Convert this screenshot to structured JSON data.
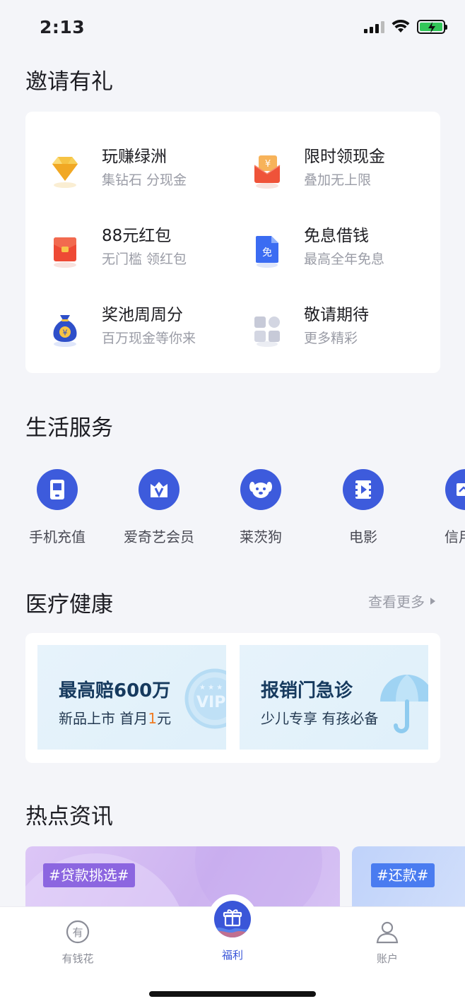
{
  "status_bar": {
    "time": "2:13"
  },
  "invite_section": {
    "title": "邀请有礼",
    "items": [
      {
        "title": "玩赚绿洲",
        "subtitle": "集钻石 分现金",
        "icon": "diamond-icon"
      },
      {
        "title": "限时领现金",
        "subtitle": "叠加无上限",
        "icon": "cash-envelope-icon"
      },
      {
        "title": "88元红包",
        "subtitle": "无门槛 领红包",
        "icon": "red-packet-icon"
      },
      {
        "title": "免息借钱",
        "subtitle": "最高全年免息",
        "icon": "interest-free-icon"
      },
      {
        "title": "奖池周周分",
        "subtitle": "百万现金等你来",
        "icon": "money-bag-icon"
      },
      {
        "title": "敬请期待",
        "subtitle": "更多精彩",
        "icon": "more-grid-icon"
      }
    ]
  },
  "life_section": {
    "title": "生活服务",
    "items": [
      {
        "label": "手机充值",
        "icon": "phone-recharge-icon"
      },
      {
        "label": "爱奇艺会员",
        "icon": "iqiyi-vip-icon"
      },
      {
        "label": "莱茨狗",
        "icon": "dog-icon"
      },
      {
        "label": "电影",
        "icon": "movie-icon"
      },
      {
        "label": "信用卡",
        "icon": "credit-card-icon"
      }
    ]
  },
  "medical_section": {
    "title": "医疗健康",
    "more": "查看更多",
    "banners": [
      {
        "title": "最高赔600万",
        "sub_pre": "新品上市 首月",
        "sub_hl": "1",
        "sub_post": "元",
        "badge": "VIP"
      },
      {
        "title": "报销门急诊",
        "subtitle": "少儿专享 有孩必备"
      }
    ]
  },
  "news_section": {
    "title": "热点资讯",
    "tags": [
      "#贷款挑选#",
      "#还款#"
    ]
  },
  "tab_bar": {
    "tabs": [
      {
        "label": "有钱花",
        "icon": "youqianhua-icon",
        "active": false
      },
      {
        "label": "福利",
        "icon": "gift-icon",
        "active": true
      },
      {
        "label": "账户",
        "icon": "user-icon",
        "active": false
      }
    ],
    "colors": {
      "active": "#3a56d8",
      "inactive": "#8b8d97"
    }
  },
  "colors": {
    "accent": "#3d5bdc",
    "highlight": "#f07b22",
    "background": "#f4f5f9"
  }
}
